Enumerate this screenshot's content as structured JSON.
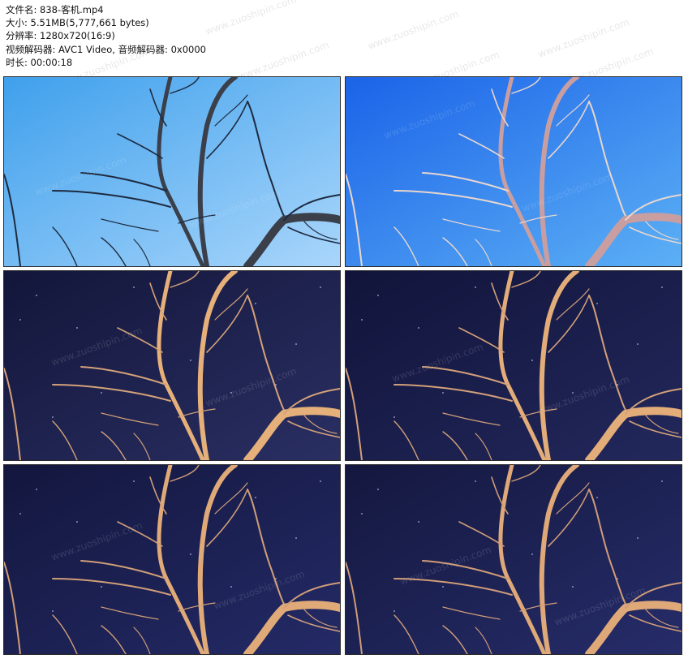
{
  "file_info": {
    "filename_line": "文件名: 838-客机.mp4",
    "size_line": "大小: 5.51MB(5,777,661 bytes)",
    "resolution_line": "分辨率: 1280x720(16:9)",
    "codec_line": "视频解码器: AVC1 Video, 音频解码器: 0x0000",
    "duration_line": "时长: 00:00:18"
  },
  "watermark": {
    "text": "www.zuoshipin.com"
  },
  "thumbnails": [
    {
      "name": "thumb-1",
      "sky_top": "#3fa0ec",
      "sky_bottom": "#a9d6fb",
      "branch": "#1e2a40",
      "trunk_light": "#3a3f4a",
      "stars": false
    },
    {
      "name": "thumb-2",
      "sky_top": "#1b63e8",
      "sky_bottom": "#5cb0f5",
      "branch": "#e9d6cf",
      "trunk_light": "#c99ea0",
      "stars": false
    },
    {
      "name": "thumb-3",
      "sky_top": "#13163a",
      "sky_bottom": "#2a2f63",
      "branch": "#d4a27a",
      "trunk_light": "#e6b07a",
      "stars": true
    },
    {
      "name": "thumb-4",
      "sky_top": "#11143a",
      "sky_bottom": "#23285c",
      "branch": "#d3a07a",
      "trunk_light": "#e3ad7a",
      "stars": true
    },
    {
      "name": "thumb-5",
      "sky_top": "#13173e",
      "sky_bottom": "#242a66",
      "branch": "#d09e78",
      "trunk_light": "#e0aa78",
      "stars": true
    },
    {
      "name": "thumb-6",
      "sky_top": "#14183f",
      "sky_bottom": "#262c69",
      "branch": "#cf9c78",
      "trunk_light": "#dea878",
      "stars": true
    }
  ]
}
